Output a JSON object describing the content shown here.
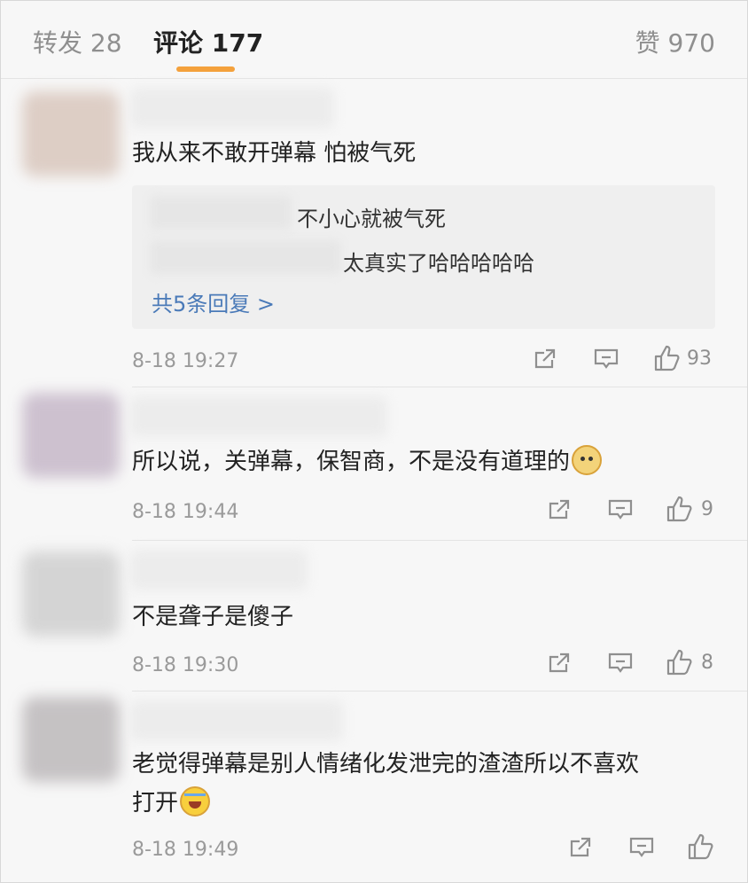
{
  "tabs": {
    "reposts": "转发 28",
    "comments": "评论 177",
    "likes": "赞 970"
  },
  "comments": [
    {
      "text": "我从来不敢开弹幕 怕被气死",
      "replies": [
        {
          "text": "不小心就被气死"
        },
        {
          "text": "太真实了哈哈哈哈哈"
        }
      ],
      "more_replies": "共5条回复 >",
      "time": "8-18 19:27",
      "likes": "93"
    },
    {
      "text": "所以说，关弹幕，保智商，不是没有道理的",
      "emoji": "doge-emoji",
      "time": "8-18 19:44",
      "likes": "9"
    },
    {
      "text": "不是聋子是傻子",
      "time": "8-18 19:30",
      "likes": "8"
    },
    {
      "text": "老觉得弹幕是别人情绪化发泄完的渣渣所以不喜欢\n打开",
      "emoji": "laughing-crying-emoji",
      "time": "8-18 19:49",
      "likes": ""
    }
  ],
  "icons": {
    "share": "share-icon",
    "comment": "comment-icon",
    "like": "thumbs-up-icon"
  },
  "colors": {
    "tab_accent": "#f4a13c",
    "link": "#4a7ab8",
    "meta": "#9a9a9a"
  }
}
